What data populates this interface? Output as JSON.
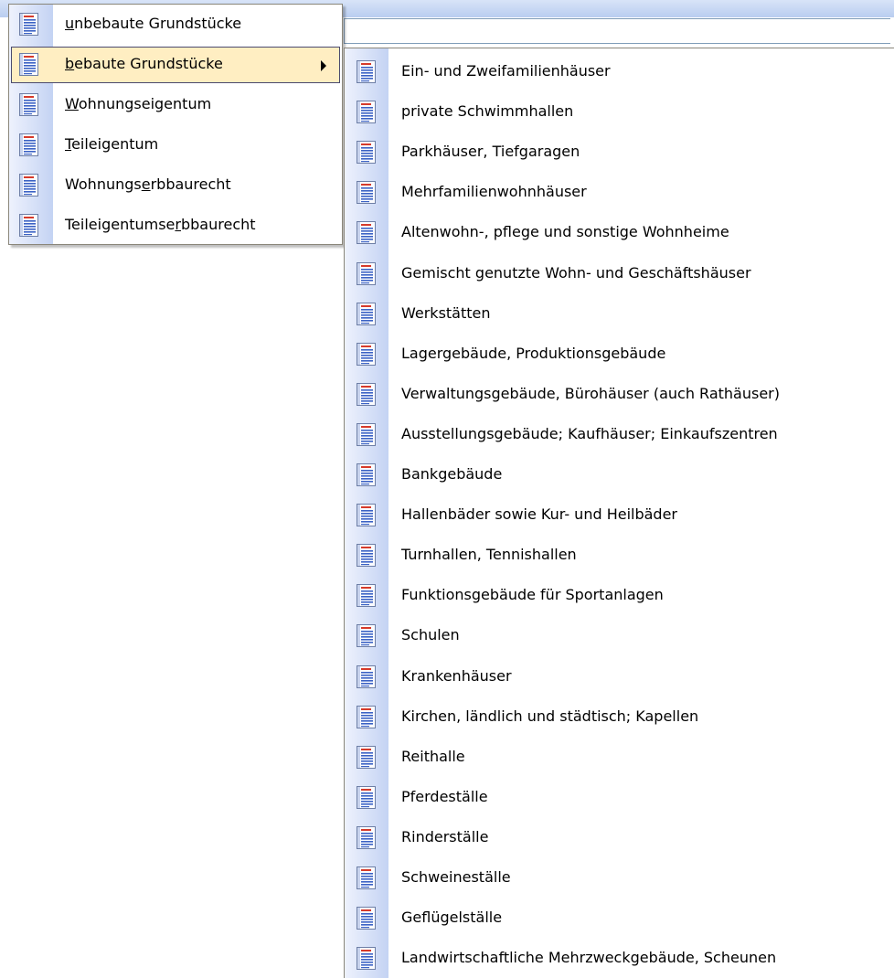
{
  "main_menu": {
    "items": [
      {
        "pre": "",
        "acc": "u",
        "post": "nbebaute Grundstücke",
        "selected": false
      },
      {
        "pre": "",
        "acc": "b",
        "post": "ebaute Grundstücke",
        "selected": true,
        "submenu": true
      },
      {
        "pre": "",
        "acc": "W",
        "post": "ohnungseigentum",
        "selected": false
      },
      {
        "pre": "",
        "acc": "T",
        "post": "eileigentum",
        "selected": false
      },
      {
        "pre": "Wohnungs",
        "acc": "e",
        "post": "rbbaurecht",
        "selected": false
      },
      {
        "pre": "Teileigentumse",
        "acc": "r",
        "post": "bbaurecht",
        "selected": false
      }
    ]
  },
  "submenu": {
    "items": [
      "Ein- und Zweifamilienhäuser",
      "private Schwimmhallen",
      "Parkhäuser, Tiefgaragen",
      "Mehrfamilienwohnhäuser",
      "Altenwohn-, pflege und sonstige Wohnheime",
      "Gemischt genutzte Wohn- und Geschäftshäuser",
      "Werkstätten",
      "Lagergebäude, Produktionsgebäude",
      "Verwaltungsgebäude, Bürohäuser (auch Rathäuser)",
      "Ausstellungsgebäude; Kaufhäuser; Einkaufszentren",
      "Bankgebäude",
      "Hallenbäder sowie Kur- und Heilbäder",
      "Turnhallen, Tennishallen",
      "Funktionsgebäude für Sportanlagen",
      "Schulen",
      "Krankenhäuser",
      "Kirchen, ländlich und städtisch; Kapellen",
      "Reithalle",
      "Pferdeställe",
      "Rinderställe",
      "Schweineställe",
      "Geflügelställe",
      "Landwirtschaftliche Mehrzweckgebäude, Scheunen"
    ]
  },
  "icon": "word-document-icon",
  "colors": {
    "highlight": "#ffeec2",
    "highlight_border": "#4b4b6f",
    "gutter_light": "#eef2fd",
    "gutter_dark": "#c4d3f3"
  }
}
